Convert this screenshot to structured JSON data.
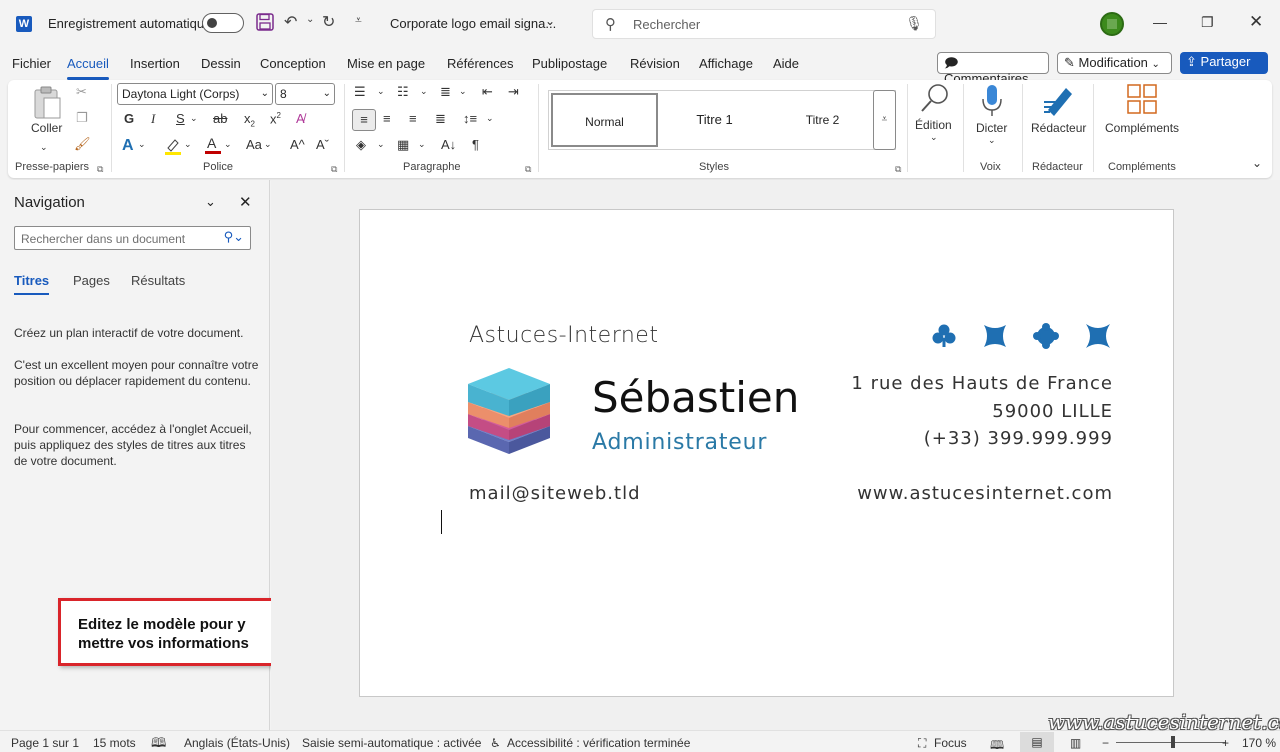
{
  "titlebar": {
    "autosave_label": "Enregistrement automatique",
    "doc_title": "Corporate logo email signa...",
    "search_placeholder": "Rechercher"
  },
  "menu": {
    "items": [
      "Fichier",
      "Accueil",
      "Insertion",
      "Dessin",
      "Conception",
      "Mise en page",
      "Références",
      "Publipostage",
      "Révision",
      "Affichage",
      "Aide"
    ],
    "active": "Accueil",
    "comments_label": "Commentaires",
    "editing_mode_label": "Modification",
    "share_label": "Partager"
  },
  "ribbon": {
    "paste_label": "Coller",
    "font_name": "Daytona Light (Corps)",
    "font_size": "8",
    "styles": [
      "Normal",
      "Titre 1",
      "Titre 2"
    ],
    "edition_label": "Édition",
    "dictate_label": "Dicter",
    "editor_label": "Rédacteur",
    "addins_label": "Compléments",
    "groups": {
      "clipboard": "Presse-papiers",
      "font": "Police",
      "paragraph": "Paragraphe",
      "styles": "Styles",
      "voice": "Voix",
      "editor": "Rédacteur",
      "addins": "Compléments"
    }
  },
  "nav": {
    "title": "Navigation",
    "search_placeholder": "Rechercher dans un document",
    "tabs": [
      "Titres",
      "Pages",
      "Résultats"
    ],
    "paragraphs": [
      "Créez un plan interactif de votre document.",
      "C'est un excellent moyen pour connaître votre position ou déplacer rapidement du contenu.",
      "Pour commencer, accédez à l'onglet Accueil, puis appliquez des styles de titres aux titres de votre document."
    ]
  },
  "callout": {
    "line1": "Editez le modèle pour y",
    "line2": "mettre vos informations"
  },
  "signature": {
    "company": "Astuces-Internet",
    "name": "Sébastien",
    "role": "Administrateur",
    "address1": "1 rue des Hauts de France",
    "address2": "59000 LILLE",
    "phone": "(+33) 399.999.999",
    "email": "mail@siteweb.tld",
    "website": "www.astucesinternet.com",
    "accent_color": "#2a79a6",
    "icon_color": "#1f6fb2"
  },
  "status": {
    "page": "Page 1 sur 1",
    "words": "15 mots",
    "language": "Anglais (États-Unis)",
    "autocomplete": "Saisie semi-automatique : activée",
    "accessibility": "Accessibilité : vérification terminée",
    "focus": "Focus",
    "zoom": "170 %"
  },
  "watermark": "www.astucesinternet.com"
}
